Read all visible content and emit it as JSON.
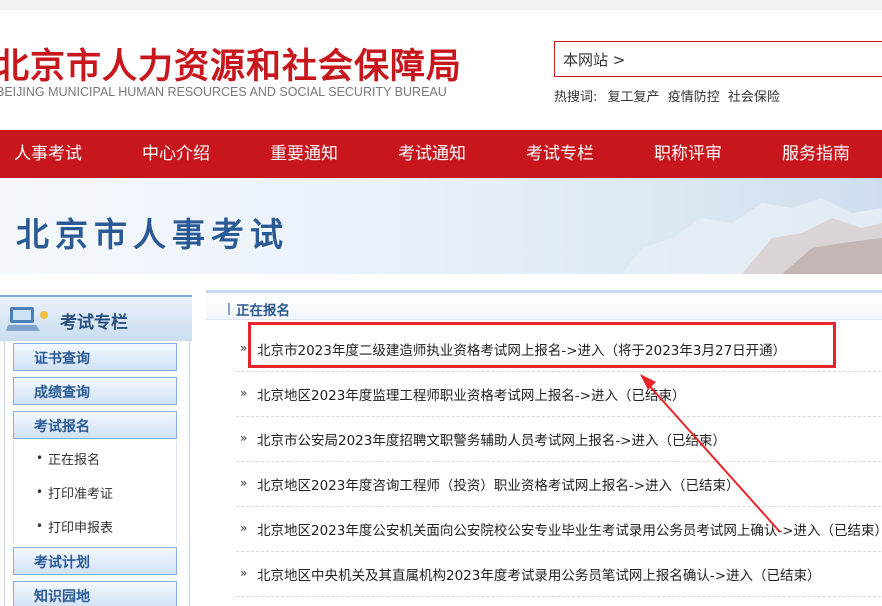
{
  "header": {
    "title": "北京市人力资源和社会保障局",
    "subtitle": "BEIJING MUNICIPAL HUMAN RESOURCES AND SOCIAL SECURITY BUREAU",
    "search_value": "本网站 >",
    "hot_label": "热搜词:",
    "hot_words": [
      "复工复产",
      "疫情防控",
      "社会保险"
    ]
  },
  "nav": {
    "items": [
      "人事考试",
      "中心介绍",
      "重要通知",
      "考试通知",
      "考试专栏",
      "职称评审",
      "服务指南"
    ]
  },
  "banner": {
    "title": "北京市人事考试"
  },
  "sidebar": {
    "title": "考试专栏",
    "buttons": [
      "证书查询",
      "成绩查询",
      "考试报名",
      "考试计划",
      "知识园地"
    ],
    "subitems": [
      "正在报名",
      "打印准考证",
      "打印申报表"
    ]
  },
  "main": {
    "section_title": "正在报名",
    "rows": [
      "北京市2023年度二级建造师执业资格考试网上报名->进入（将于2023年3月27日开通）",
      "北京地区2023年度监理工程师职业资格考试网上报名->进入（已结束）",
      "北京市公安局2023年度招聘文职警务辅助人员考试网上报名->进入（已结束）",
      "北京地区2023年度咨询工程师（投资）职业资格考试网上报名->进入（已结束）",
      "北京地区2023年度公安机关面向公安院校公安专业毕业生考试录用公务员考试网上确认->进入（已结束）",
      "北京地区中央机关及其直属机构2023年度考试录用公务员笔试网上报名确认->进入（已结束）"
    ]
  },
  "colors": {
    "brand_red": "#c8161d",
    "link_blue": "#2a5a96",
    "highlight_red": "#e8242b"
  }
}
